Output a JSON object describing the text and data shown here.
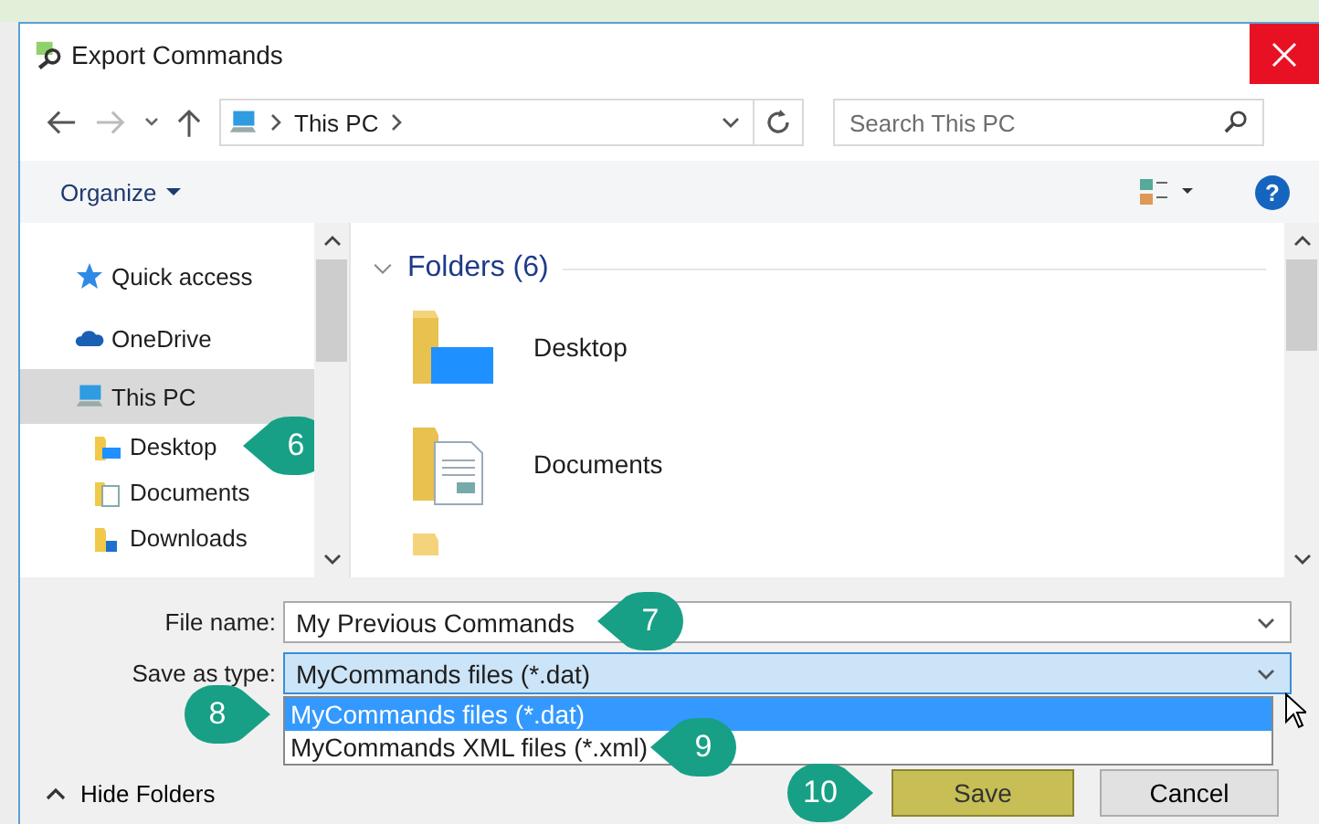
{
  "window": {
    "title": "Export Commands"
  },
  "address_bar": {
    "path": [
      "This PC"
    ]
  },
  "search": {
    "placeholder": "Search This PC"
  },
  "toolbar": {
    "organize": "Organize",
    "help": "?"
  },
  "nav_pane": {
    "items": [
      {
        "label": "Quick access",
        "kind": "star",
        "selected": false
      },
      {
        "label": "OneDrive",
        "kind": "cloud",
        "selected": false
      },
      {
        "label": "This PC",
        "kind": "pc",
        "selected": true,
        "children": [
          {
            "label": "Desktop",
            "kind": "desktop",
            "selected": false,
            "callout": "6"
          },
          {
            "label": "Documents",
            "kind": "documents",
            "selected": false
          },
          {
            "label": "Downloads",
            "kind": "downloads",
            "selected": false
          }
        ]
      }
    ]
  },
  "content": {
    "group_title": "Folders (6)",
    "expanded": true,
    "folders": [
      {
        "name": "Desktop",
        "kind": "desktop"
      },
      {
        "name": "Documents",
        "kind": "documents"
      }
    ]
  },
  "file_name": {
    "label": "File name:",
    "value": "My Previous Commands",
    "callout": "7"
  },
  "save_as_type": {
    "label": "Save as type:",
    "value": "MyCommands files (*.dat)",
    "expanded": true,
    "options": [
      {
        "label": "MyCommands files (*.dat)",
        "selected": true,
        "callout": "8"
      },
      {
        "label": "MyCommands XML files (*.xml)",
        "selected": false,
        "callout": "9"
      }
    ]
  },
  "hide_folders": "Hide Folders",
  "buttons": [
    {
      "label": "Save",
      "kind": "save",
      "callout": "10"
    },
    {
      "label": "Cancel",
      "kind": "cancel"
    }
  ]
}
